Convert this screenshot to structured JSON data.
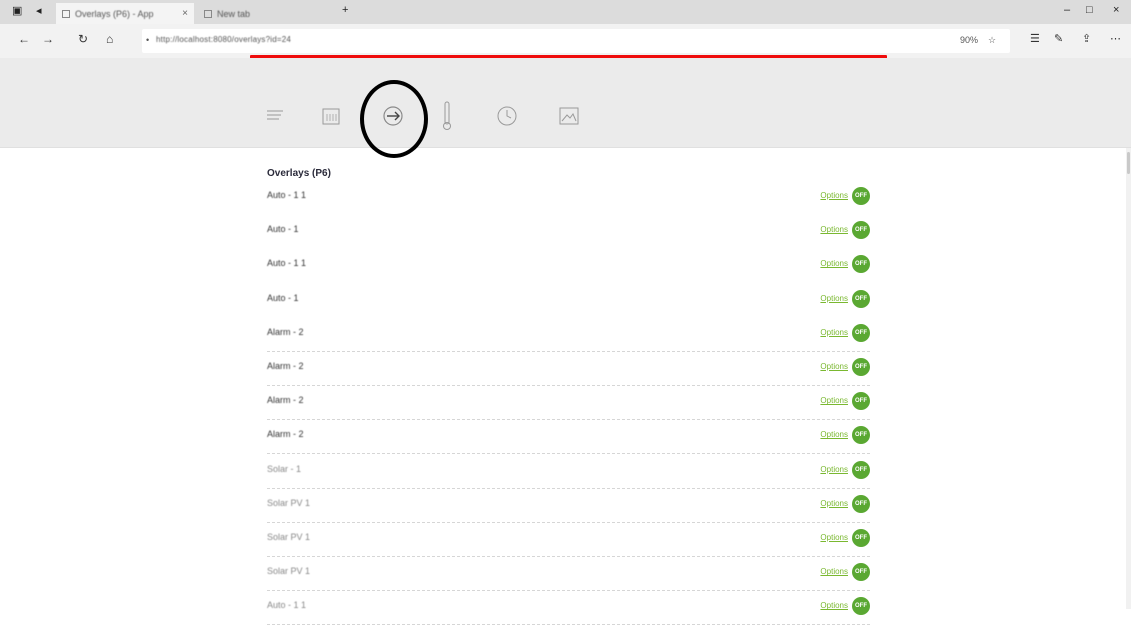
{
  "browser": {
    "active_tab_title": "Overlays (P6) - App",
    "other_tab_title": "New tab",
    "url": "http://localhost:8080/overlays?id=24",
    "zoom": "90%"
  },
  "toolbar": {
    "tools": [
      {
        "name": "list"
      },
      {
        "name": "calendar"
      },
      {
        "name": "arrow-circle"
      },
      {
        "name": "thermometer"
      },
      {
        "name": "clock"
      },
      {
        "name": "image"
      }
    ]
  },
  "section": {
    "title": "Overlays (P6)"
  },
  "rows": [
    {
      "label": "Auto - 1 1",
      "link": "Options",
      "toggle": "OFF"
    },
    {
      "label": "Auto - 1",
      "link": "Options",
      "toggle": "OFF"
    },
    {
      "label": "Auto - 1 1",
      "link": "Options",
      "toggle": "OFF"
    },
    {
      "label": "Auto - 1",
      "link": "Options",
      "toggle": "OFF"
    },
    {
      "label": "Alarm - 2",
      "link": "Options",
      "toggle": "OFF"
    },
    {
      "label": "Alarm - 2",
      "link": "Options",
      "toggle": "OFF"
    },
    {
      "label": "Alarm - 2",
      "link": "Options",
      "toggle": "OFF"
    },
    {
      "label": "Alarm - 2",
      "link": "Options",
      "toggle": "OFF"
    },
    {
      "label": "Solar - 1",
      "link": "Options",
      "toggle": "OFF"
    },
    {
      "label": "Solar PV 1",
      "link": "Options",
      "toggle": "OFF"
    },
    {
      "label": "Solar PV 1",
      "link": "Options",
      "toggle": "OFF"
    },
    {
      "label": "Solar PV 1",
      "link": "Options",
      "toggle": "OFF"
    },
    {
      "label": "Auto - 1 1",
      "link": "Options",
      "toggle": "OFF"
    }
  ],
  "colors": {
    "progress": "#ef0c0c",
    "link": "#7ab830",
    "toggle": "#5aa832"
  }
}
